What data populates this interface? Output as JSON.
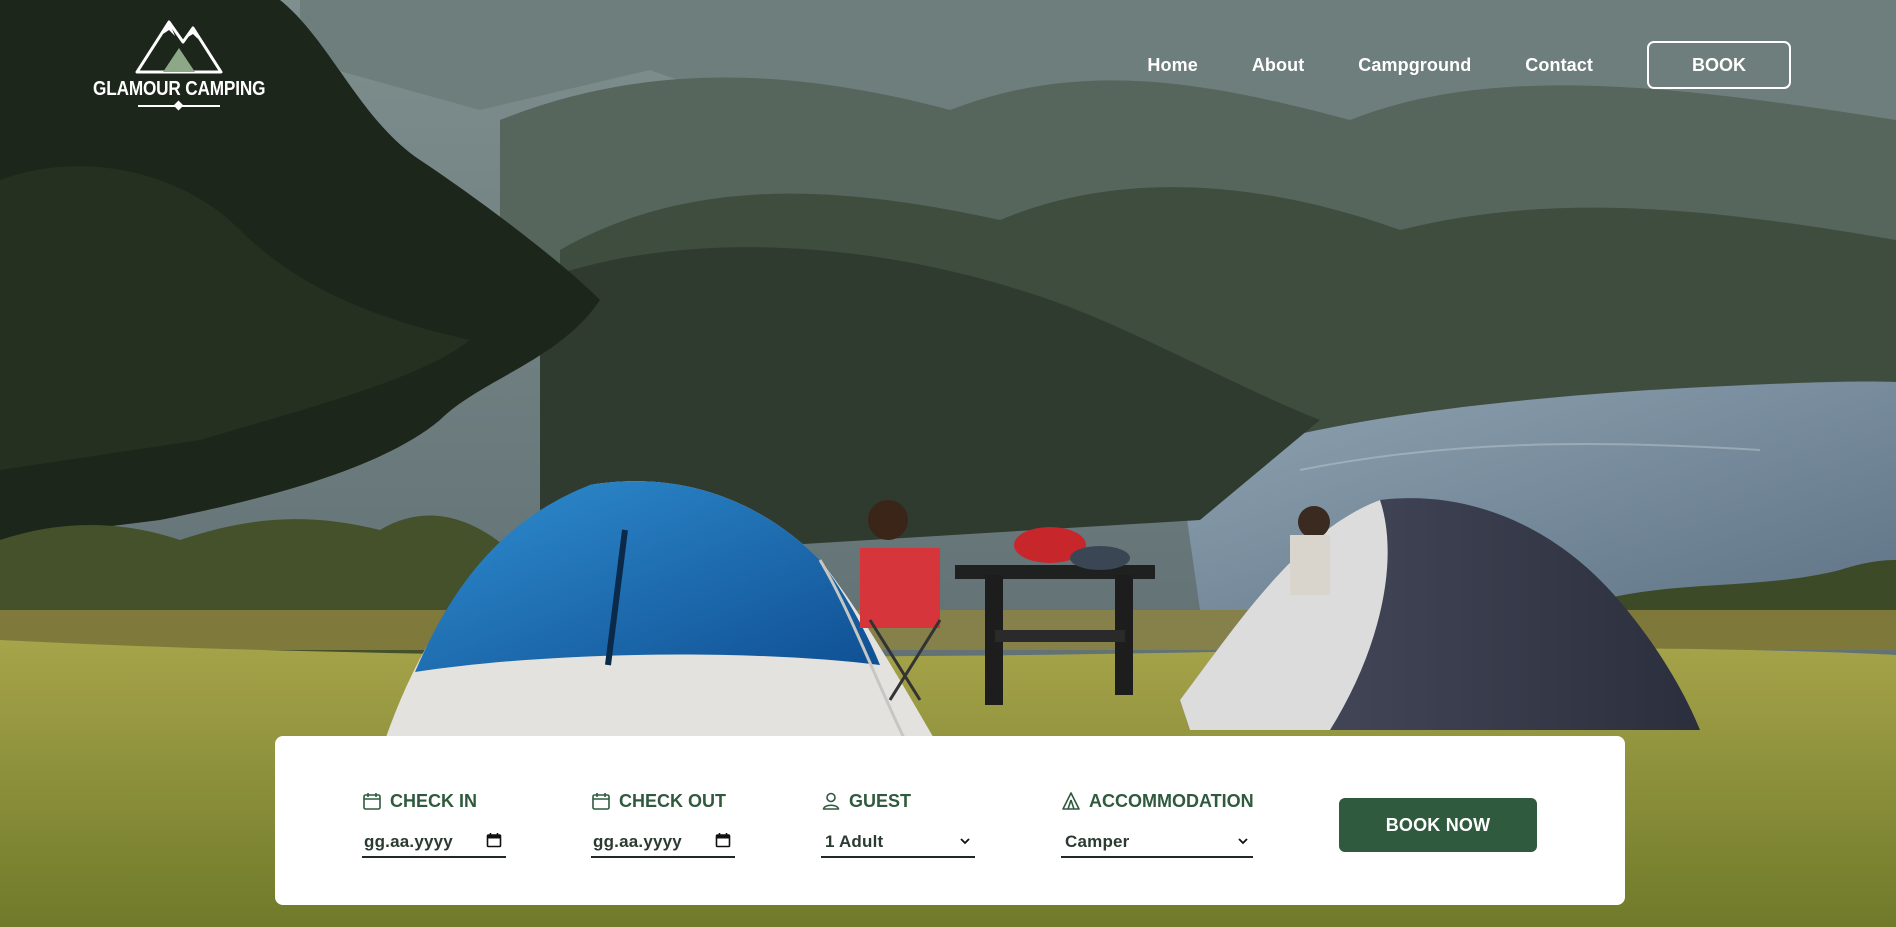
{
  "brand": {
    "name": "GLAMOUR CAMPING"
  },
  "nav": {
    "links": [
      "Home",
      "About",
      "Campground",
      "Contact"
    ],
    "book_label": "BOOK"
  },
  "booking": {
    "check_in": {
      "label": "CHECK IN",
      "value": "gg.aa.yyyy",
      "icon": "calendar-icon"
    },
    "check_out": {
      "label": "CHECK OUT",
      "value": "gg.aa.yyyy",
      "icon": "calendar-icon"
    },
    "guest": {
      "label": "GUEST",
      "value": "1 Adult",
      "icon": "user-icon"
    },
    "accommodation": {
      "label": "ACCOMMODATION",
      "value": "Camper",
      "icon": "tent-icon"
    },
    "submit_label": "BOOK NOW"
  },
  "colors": {
    "accent": "#2f5a3d",
    "text_on_hero": "#ffffff",
    "panel_bg": "#ffffff"
  }
}
